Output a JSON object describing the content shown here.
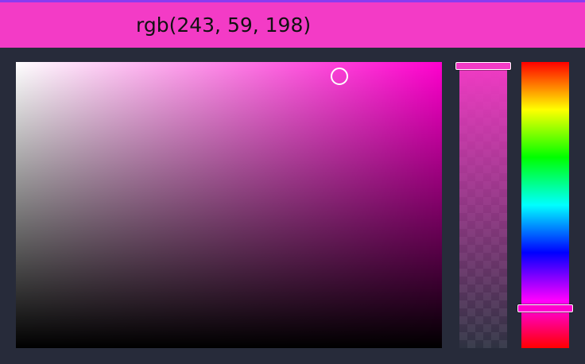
{
  "color_display": {
    "text": "rgb(243, 59, 198)",
    "swatch_color": "#f33bc6",
    "accent_color": "#8a3cf0"
  },
  "color": {
    "r": 243,
    "g": 59,
    "b": 198,
    "hex": "#f33bc6",
    "hue_color": "#ff00ce",
    "saturation": 0.76,
    "brightness": 0.95,
    "alpha": 1.0,
    "hue_fraction": 0.86
  }
}
